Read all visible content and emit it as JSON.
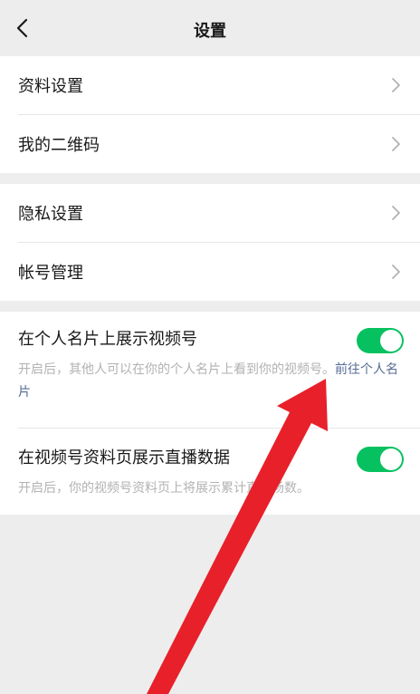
{
  "nav": {
    "title": "设置",
    "back_icon": "chevron-left-icon"
  },
  "group1": [
    {
      "label": "资料设置"
    },
    {
      "label": "我的二维码"
    }
  ],
  "group2": [
    {
      "label": "隐私设置"
    },
    {
      "label": "帐号管理"
    }
  ],
  "toggles": [
    {
      "label": "在个人名片上展示视频号",
      "desc": "开启后，其他人可以在你的个人名片上看到你的视频号。",
      "link": "前往个人名片",
      "on": true
    },
    {
      "label": "在视频号资料页展示直播数据",
      "desc": "开启后，你的视频号资料页上将展示累计直播场数。",
      "on": true
    }
  ],
  "colors": {
    "switch_on": "#07c160",
    "link": "#576b95",
    "annotation_arrow": "#e8202a",
    "background": "#ededed"
  }
}
